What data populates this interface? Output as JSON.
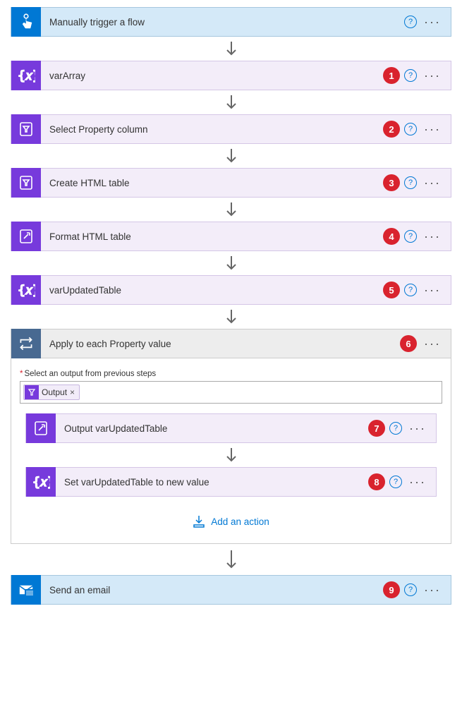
{
  "steps": {
    "trigger": {
      "title": "Manually trigger a flow"
    },
    "s1": {
      "title": "varArray",
      "badge": "1"
    },
    "s2": {
      "title": "Select Property column",
      "badge": "2"
    },
    "s3": {
      "title": "Create HTML table",
      "badge": "3"
    },
    "s4": {
      "title": "Format HTML table",
      "badge": "4"
    },
    "s5": {
      "title": "varUpdatedTable",
      "badge": "5"
    },
    "s6": {
      "title": "Apply to each Property value",
      "badge": "6"
    },
    "s7": {
      "title": "Output varUpdatedTable",
      "badge": "7"
    },
    "s8": {
      "title": "Set varUpdatedTable to new value",
      "badge": "8"
    },
    "s9": {
      "title": "Send an email",
      "badge": "9"
    }
  },
  "container": {
    "fieldLabel": "Select an output from previous steps",
    "chipLabel": "Output",
    "addAction": "Add an action"
  }
}
